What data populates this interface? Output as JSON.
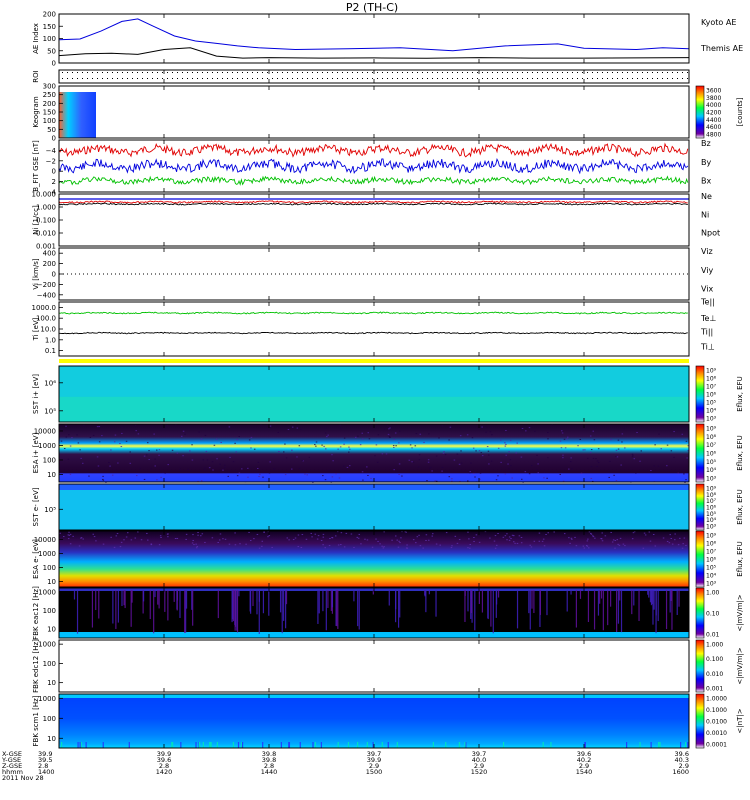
{
  "title": "P2 (TH-C)",
  "colors": {
    "blue": "#0000dd",
    "red": "#e00000",
    "green": "#00c000",
    "black": "#000000"
  },
  "chart_data": [
    {
      "type": "line",
      "ylabel": "AE Index",
      "ylim": [
        0,
        200
      ],
      "yticks": [
        "0",
        "50",
        "100",
        "150",
        "200"
      ],
      "series": [
        {
          "name": "Kyoto AE",
          "color": "blue",
          "x": [
            0,
            4,
            8,
            12,
            15,
            18,
            22,
            26,
            30,
            34,
            38,
            45,
            55,
            65,
            75,
            85,
            95,
            100,
            110,
            115,
            120
          ],
          "values": [
            95,
            98,
            130,
            170,
            180,
            150,
            110,
            90,
            80,
            70,
            62,
            55,
            58,
            62,
            50,
            70,
            78,
            60,
            55,
            62,
            58
          ]
        },
        {
          "name": "Themis AE",
          "color": "black",
          "x": [
            0,
            5,
            10,
            15,
            20,
            25,
            30,
            35,
            40,
            50,
            60,
            70,
            80,
            90,
            100,
            110,
            120
          ],
          "values": [
            30,
            38,
            40,
            35,
            55,
            62,
            28,
            20,
            22,
            20,
            21,
            19,
            22,
            20,
            20,
            21,
            22
          ]
        }
      ]
    },
    {
      "type": "scatter",
      "ylabel": "ROI",
      "description": "dotted markers"
    },
    {
      "type": "heatmap",
      "ylabel": "Keogram",
      "ylim": [
        0,
        300
      ],
      "yticks": [
        "0",
        "50",
        "100",
        "150",
        "200",
        "250",
        "300"
      ],
      "colorbar": {
        "label": "[counts]",
        "ticks": [
          "3600",
          "3800",
          "4000",
          "4200",
          "4400",
          "4600",
          "4800"
        ]
      }
    },
    {
      "type": "line",
      "ylabel": "B_FIT GSE [nT]",
      "ylim": [
        -6,
        4
      ],
      "yticks": [
        "−4",
        "−2",
        "0",
        "2",
        "4"
      ],
      "series": [
        {
          "name": "Bz",
          "color": "red",
          "approx_level": 2.0
        },
        {
          "name": "By",
          "color": "green",
          "approx_level": -3.8
        },
        {
          "name": "Bx",
          "color": "blue",
          "approx_level": -1.0
        }
      ]
    },
    {
      "type": "line",
      "ylabel": "Ni [1/cc]",
      "log": true,
      "yticks": [
        "10.000",
        "1.000",
        "0.100",
        "0.010",
        "0.001"
      ],
      "series": [
        {
          "name": "Ne",
          "color": "red",
          "approx_level": 0.55
        },
        {
          "name": "Ni",
          "color": "black",
          "approx_level": 0.45
        },
        {
          "name": "Npot",
          "color": "blue",
          "approx_level": 0.65
        }
      ]
    },
    {
      "type": "line",
      "ylabel": "Vi [km/s]",
      "ylim": [
        -500,
        500
      ],
      "yticks": [
        "400",
        "200",
        "0",
        "−200",
        "−400"
      ],
      "series": [
        {
          "name": "Viz",
          "color": "red",
          "approx_level": 0
        },
        {
          "name": "Viy",
          "color": "green",
          "approx_level": 0
        },
        {
          "name": "Vix",
          "color": "blue",
          "approx_level": 0
        }
      ]
    },
    {
      "type": "line",
      "ylabel": "Ti [eV]",
      "log": true,
      "yticks": [
        "1000.0",
        "100.0",
        "10.0",
        "1.0",
        "0.1"
      ],
      "series": [
        {
          "name": "Te||",
          "color": "black",
          "approx_level": 10
        },
        {
          "name": "Te⊥",
          "color": "red"
        },
        {
          "name": "Ti||",
          "color": "green",
          "approx_level": 700
        },
        {
          "name": "Ti⊥",
          "color": "blue"
        }
      ]
    },
    {
      "type": "heatmap",
      "ylabel": "SST i+ [eV]",
      "yticks": [
        "10⁶",
        "10⁵"
      ],
      "colorbar": {
        "label": "Eflux, EFU",
        "ticks": [
          "10⁹",
          "10⁸",
          "10⁷",
          "10⁶",
          "10⁵",
          "10⁴",
          "10³"
        ]
      }
    },
    {
      "type": "heatmap",
      "ylabel": "ESA i+ [eV]",
      "yticks": [
        "10000",
        "1000",
        "100",
        "10"
      ],
      "colorbar": {
        "label": "Eflux, EFU",
        "ticks": [
          "10⁹",
          "10⁸",
          "10⁷",
          "10⁶",
          "10⁵",
          "10⁴",
          "10³"
        ]
      }
    },
    {
      "type": "heatmap",
      "ylabel": "SST e- [eV]",
      "yticks": [
        "10⁵"
      ],
      "colorbar": {
        "label": "Eflux, EFU",
        "ticks": [
          "10⁹",
          "10⁸",
          "10⁷",
          "10⁶",
          "10⁵",
          "10⁴",
          "10³"
        ]
      }
    },
    {
      "type": "heatmap",
      "ylabel": "ESA e- [eV]",
      "yticks": [
        "10000",
        "1000",
        "100",
        "10"
      ],
      "colorbar": {
        "label": "Eflux, EFU",
        "ticks": [
          "10⁹",
          "10⁸",
          "10⁷",
          "10⁶",
          "10⁵",
          "10⁴",
          "10³"
        ]
      }
    },
    {
      "type": "heatmap",
      "ylabel": "FBK eac12 [Hz]",
      "yticks": [
        "1000",
        "100",
        "10"
      ],
      "colorbar": {
        "label": "<|mV/m|>",
        "ticks": [
          "1.00",
          "0.10",
          "0.01"
        ]
      }
    },
    {
      "type": "heatmap",
      "ylabel": "FBK edc12 [Hz]",
      "yticks": [
        "1000",
        "100",
        "10"
      ],
      "colorbar": {
        "label": "<|mV/m|>",
        "ticks": [
          "1.000",
          "0.100",
          "0.010",
          "0.001"
        ]
      }
    },
    {
      "type": "heatmap",
      "ylabel": "FBK scm1 [Hz]",
      "yticks": [
        "1000",
        "100",
        "10"
      ],
      "colorbar": {
        "label": "<|nT|>",
        "ticks": [
          "1.0000",
          "0.1000",
          "0.0100",
          "0.0010",
          "0.0001"
        ]
      }
    }
  ],
  "xaxis": {
    "row_labels": [
      "X-GSE",
      "Y-GSE",
      "Z-GSE",
      "hhmm",
      "2011 Nov 28"
    ],
    "ticks": [
      {
        "hhmm": "1400",
        "x": "39.9",
        "y": "39.5",
        "z": "2.8"
      },
      {
        "hhmm": "1420",
        "x": "39.9",
        "y": "39.6",
        "z": "2.8"
      },
      {
        "hhmm": "1440",
        "x": "39.8",
        "y": "39.8",
        "z": "2.8"
      },
      {
        "hhmm": "1500",
        "x": "39.7",
        "y": "39.9",
        "z": "2.9"
      },
      {
        "hhmm": "1520",
        "x": "39.7",
        "y": "40.0",
        "z": "2.9"
      },
      {
        "hhmm": "1540",
        "x": "39.6",
        "y": "40.2",
        "z": "2.9"
      },
      {
        "hhmm": "1600",
        "x": "39.6",
        "y": "40.3",
        "z": "2.9"
      }
    ]
  }
}
